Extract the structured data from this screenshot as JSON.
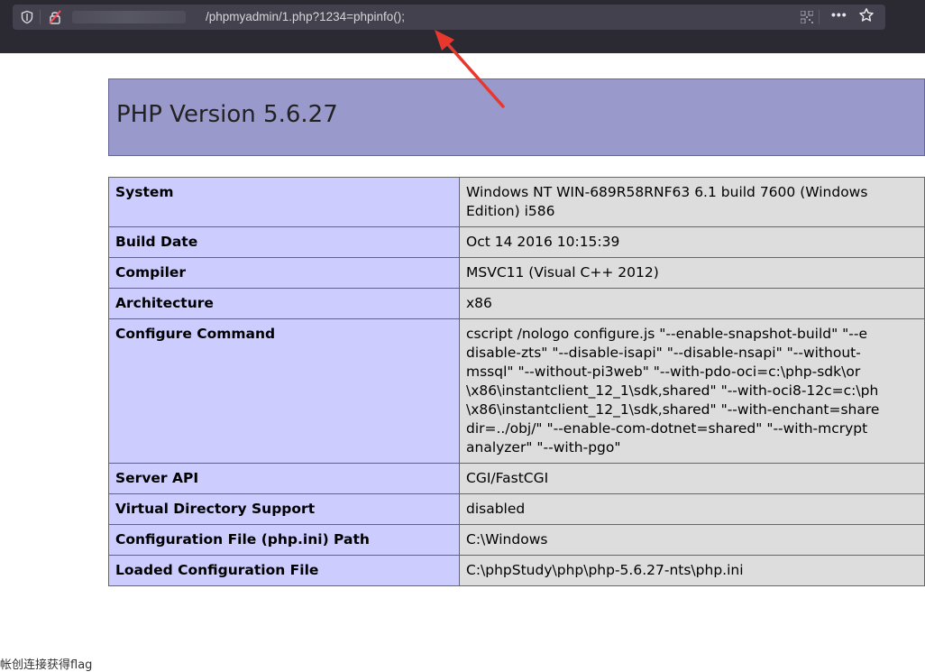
{
  "browser": {
    "url": "/phpmyadmin/1.php?1234=phpinfo();",
    "more_label": "•••"
  },
  "php": {
    "title": "PHP Version 5.6.27"
  },
  "rows": [
    {
      "key": "System",
      "value": "Windows NT WIN-689R58RNF63 6.1 build 7600 (Windows\nEdition) i586"
    },
    {
      "key": "Build Date",
      "value": "Oct 14 2016 10:15:39"
    },
    {
      "key": "Compiler",
      "value": "MSVC11 (Visual C++ 2012)"
    },
    {
      "key": "Architecture",
      "value": "x86"
    },
    {
      "key": "Configure Command",
      "value": "cscript /nologo configure.js \"--enable-snapshot-build\" \"--e\ndisable-zts\" \"--disable-isapi\" \"--disable-nsapi\" \"--without-\nmssql\" \"--without-pi3web\" \"--with-pdo-oci=c:\\php-sdk\\or\n\\x86\\instantclient_12_1\\sdk,shared\" \"--with-oci8-12c=c:\\ph\n\\x86\\instantclient_12_1\\sdk,shared\" \"--with-enchant=share\ndir=../obj/\" \"--enable-com-dotnet=shared\" \"--with-mcrypt\nanalyzer\" \"--with-pgo\""
    },
    {
      "key": "Server API",
      "value": "CGI/FastCGI"
    },
    {
      "key": "Virtual Directory Support",
      "value": "disabled"
    },
    {
      "key": "Configuration File (php.ini) Path",
      "value": "C:\\Windows"
    },
    {
      "key": "Loaded Configuration File",
      "value": "C:\\phpStudy\\php\\php-5.6.27-nts\\php.ini"
    }
  ],
  "footer": {
    "text": "帐创连接获得flag"
  },
  "colors": {
    "header_bg": "#9999cc",
    "key_bg": "#ccccff",
    "value_bg": "#dddddd",
    "arrow": "#e8382e"
  }
}
